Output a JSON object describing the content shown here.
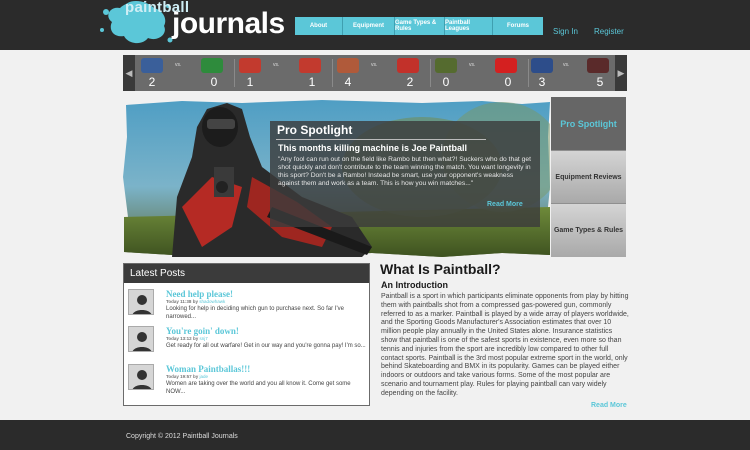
{
  "header": {
    "logo_small": "paintball",
    "logo_big": "journals",
    "nav": [
      "About",
      "Equipment",
      "Game Types & Rules",
      "Paintball Leagues",
      "Forums"
    ],
    "sign_in": "Sign In",
    "register": "Register"
  },
  "scores": {
    "vs_label": "vs.",
    "games": [
      {
        "home_score": "2",
        "away_score": "0",
        "home_color": "#3a5f9a",
        "away_color": "#2e8b3c"
      },
      {
        "home_score": "1",
        "away_score": "1",
        "home_color": "#c23a2e",
        "away_color": "#c23a2e"
      },
      {
        "home_score": "4",
        "away_score": "2",
        "home_color": "#b05a3a",
        "away_color": "#c2312a"
      },
      {
        "home_score": "0",
        "away_score": "0",
        "home_color": "#556b2f",
        "away_color": "#d42020"
      },
      {
        "home_score": "3",
        "away_score": "5",
        "home_color": "#2d4d8a",
        "away_color": "#5a2a2a"
      }
    ]
  },
  "spotlight": {
    "title": "Pro Spotlight",
    "subtitle": "This months killing machine is Joe Paintball",
    "text": "\"Any fool can run out on the field like Rambo but then what?! Suckers who do that get shot quickly and don't contribute to the team winning the match. You want longevity in this sport? Don't be a Rambo! Instead be smart, use your opponent's weakness against them and work as a team. This is how you win matches...\"",
    "read_more": "Read More"
  },
  "tabs": [
    "Pro Spotlight",
    "Equipment Reviews",
    "Game Types & Rules"
  ],
  "latest_posts": {
    "heading": "Latest Posts",
    "posts": [
      {
        "title": "Need help please!",
        "time": "Today 11:38",
        "by": "by",
        "author": "shadowhawk",
        "body": "Looking for help in deciding which gun to purchase next. So far I've narrowed..."
      },
      {
        "title": "You're goin' down!",
        "time": "Today 13:12",
        "by": "by",
        "author": "snj7",
        "body": "Get ready for all out warfare! Get in our way and you're gonna pay! I'm so..."
      },
      {
        "title": "Woman Paintballas!!!",
        "time": "Today 19:57",
        "by": "by",
        "author": "jade",
        "body": "Women are taking over the world and you all know it. Come get some NOW..."
      }
    ]
  },
  "what_is": {
    "title": "What Is Paintball?",
    "subtitle": "An Introduction",
    "text": "Paintball is a sport in which participants eliminate opponents from play by hitting them with paintballs shot from a compressed gas-powered gun, commonly referred to as a marker. Paintball is played by a wide array of players worldwide, and the Sporting Goods Manufacturer's Association estimates that over 10 million people play annually in the United States alone. Insurance statistics show that paintball is one of the safest sports in existence, even more so than tennis and injuries from the sport are incredibly low compared to other full contact sports.  Paintball is the 3rd most popular extreme sport in the world, only behind Skateboarding and BMX in its popularity.  Games can be played either indoors or outdoors and take various forms.  Some of the most popular are scenario and tournament play.  Rules for playing paintball can vary widely depending on the facility.",
    "read_more": "Read More"
  },
  "footer": {
    "copyright": "Copyright © 2012 Paintball Journals"
  }
}
